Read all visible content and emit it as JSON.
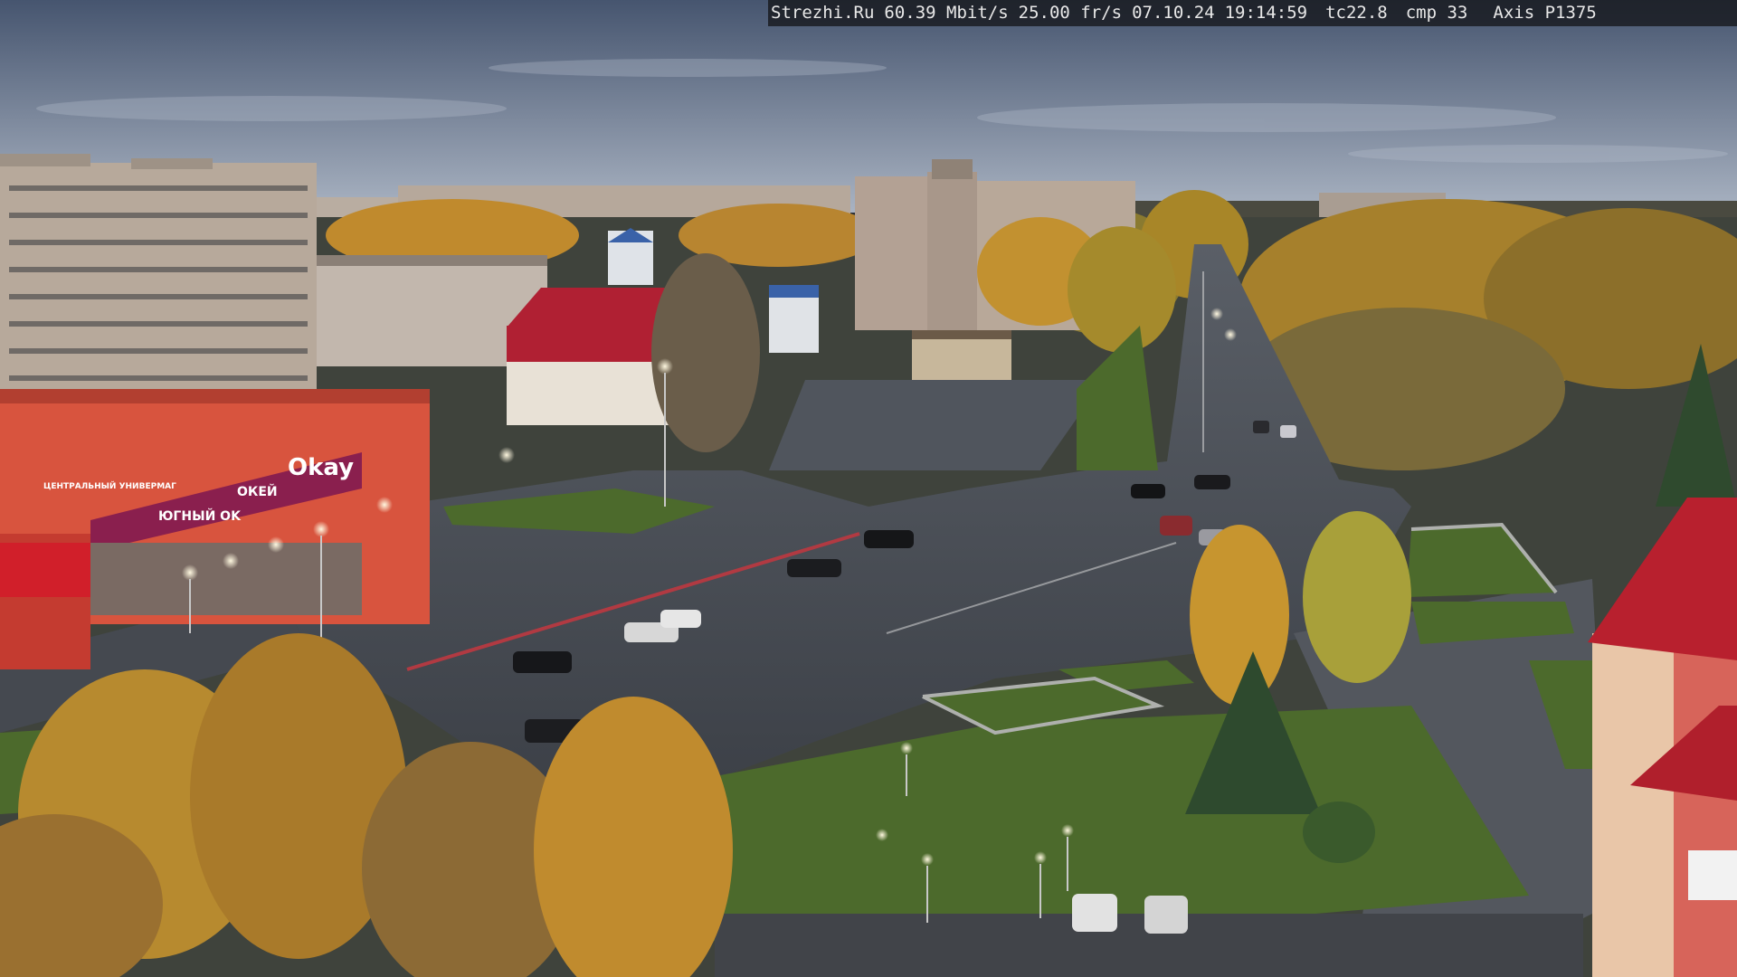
{
  "camera_overlay": {
    "site": "Strezhi.Ru",
    "bitrate": "60.39 Mbit/s",
    "framerate": "25.00 fr/s",
    "date": "07.10.24",
    "time": "19:14:59",
    "tc": "tc22.8",
    "cmp": "cmp 33",
    "camera_model": "Axis P1375"
  },
  "signs": {
    "store_main": "Okay",
    "store_left": "ЮГНЫЙ OK",
    "store_mid": "ОКЕЙ",
    "shop_label": "ЦЕНТРАЛЬНЫЙ УНИВЕРМАГ"
  },
  "colors": {
    "sky_top": "#4b5a75",
    "sky_bottom": "#9aa6b8",
    "road": "#4a4f58",
    "store_red": "#d8433a",
    "store_purple": "#8a1f4e",
    "grass": "#4c6a2c",
    "tree_autumn": "#c79530",
    "roof_red": "#b8202e"
  }
}
